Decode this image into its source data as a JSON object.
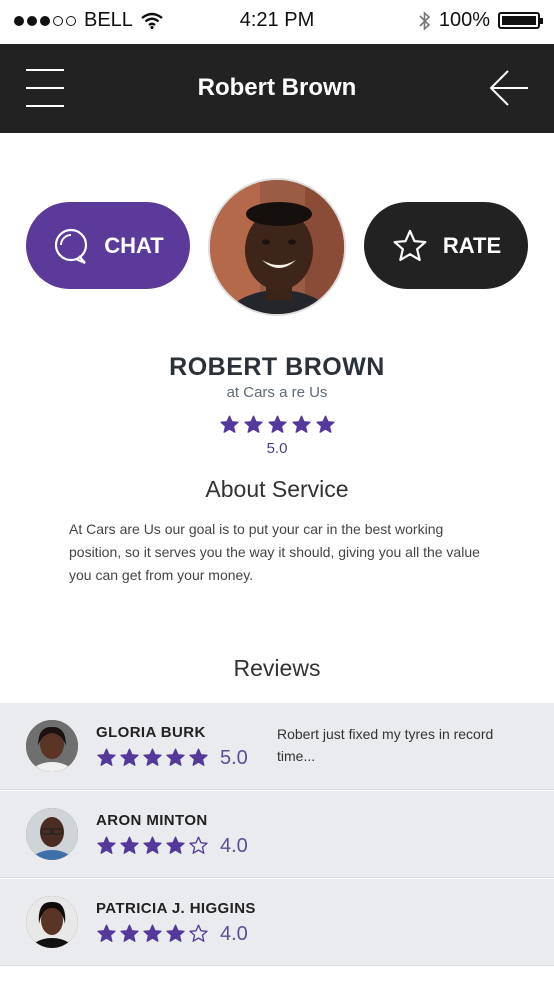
{
  "status_bar": {
    "carrier": "BELL",
    "time": "4:21 PM",
    "battery": "100%",
    "signal_icon": "signal-dots-icon",
    "wifi_icon": "wifi-icon",
    "bluetooth_icon": "bluetooth-icon",
    "battery_icon": "battery-icon"
  },
  "nav": {
    "title": "Robert Brown",
    "menu_icon": "hamburger-menu-icon",
    "back_icon": "arrow-left-icon"
  },
  "actions": {
    "chat_label": "CHAT",
    "rate_label": "RATE",
    "chat_icon": "chat-bubble-icon",
    "rate_icon": "star-outline-icon"
  },
  "profile": {
    "name": "ROBERT BROWN",
    "company": "at Cars a re Us",
    "rating": "5.0",
    "stars_filled": 5
  },
  "about": {
    "heading": "About Service",
    "text": "At Cars are Us our goal is to put your car in the best working position, so it serves you the way it should, giving you all the value you can get from your money."
  },
  "reviews": {
    "heading": "Reviews",
    "items": [
      {
        "name": "GLORIA BURK",
        "score": "5.0",
        "stars_filled": 5,
        "comment": "Robert  just fixed my tyres in record time..."
      },
      {
        "name": "ARON MINTON",
        "score": "4.0",
        "stars_filled": 4,
        "comment": ""
      },
      {
        "name": "PATRICIA J. HIGGINS",
        "score": "4.0",
        "stars_filled": 4,
        "comment": ""
      }
    ]
  },
  "colors": {
    "accent": "#5b3a9a",
    "nav_bg": "#222222",
    "review_bg": "#e9ebef",
    "star": "#55399a"
  }
}
